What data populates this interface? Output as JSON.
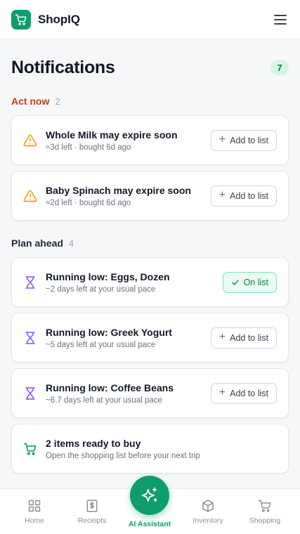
{
  "app": {
    "name": "ShopIQ"
  },
  "page": {
    "title": "Notifications",
    "count": "7"
  },
  "sections": {
    "urgent": {
      "title": "Act now",
      "count": "2",
      "items": [
        {
          "title": "Whole Milk may expire soon",
          "subtitle": "≈3d left · bought 6d ago",
          "action": "Add to list"
        },
        {
          "title": "Baby Spinach may expire soon",
          "subtitle": "≈2d left · bought 6d ago",
          "action": "Add to list"
        }
      ]
    },
    "plan": {
      "title": "Plan ahead",
      "count": "4",
      "items": [
        {
          "title": "Running low: Eggs, Dozen",
          "subtitle": "~2 days left at your usual pace",
          "action": "On list"
        },
        {
          "title": "Running low: Greek Yogurt",
          "subtitle": "~5 days left at your usual pace",
          "action": "Add to list"
        },
        {
          "title": "Running low: Coffee Beans",
          "subtitle": "~6.7 days left at your usual pace",
          "action": "Add to list"
        },
        {
          "title": "2 items ready to buy",
          "subtitle": "Open the shopping list before your next trip"
        }
      ]
    }
  },
  "nav": {
    "home": "Home",
    "receipts": "Receipts",
    "ai": "AI Assistant",
    "inventory": "Inventory",
    "shopping": "Shopping"
  },
  "colors": {
    "brand": "#0f9d6b",
    "warning": "#f59e0b",
    "low_stock": "#8b5cf6",
    "urgent_heading": "#c2410c"
  },
  "icons": {
    "logo": "cart-icon",
    "menu": "hamburger-menu-icon",
    "expiry": "warning-triangle-icon",
    "low_stock": "hourglass-icon",
    "ready": "cart-icon",
    "ai": "sparkles-icon"
  }
}
